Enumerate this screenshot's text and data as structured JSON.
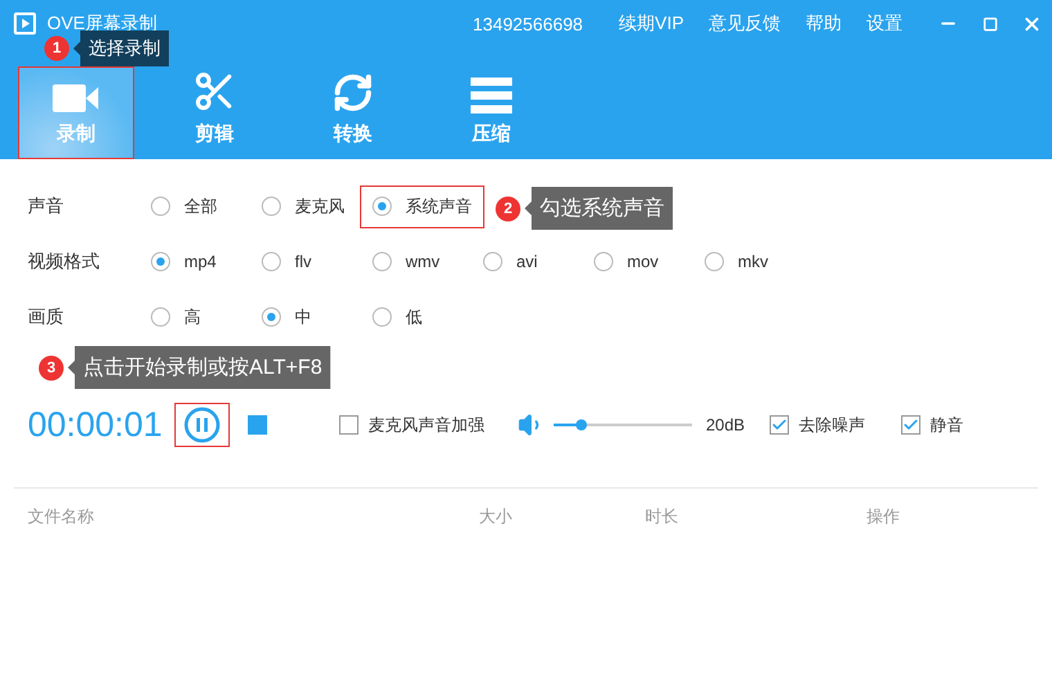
{
  "window": {
    "title": "OVE屏幕录制",
    "account": "13492566698",
    "links": [
      "续期VIP",
      "意见反馈",
      "帮助",
      "设置"
    ]
  },
  "tabs": [
    {
      "label": "录制",
      "selected": true,
      "highlighted": true
    },
    {
      "label": "剪辑",
      "selected": false,
      "highlighted": false
    },
    {
      "label": "转换",
      "selected": false,
      "highlighted": false
    },
    {
      "label": "压缩",
      "selected": false,
      "highlighted": false
    }
  ],
  "settings": [
    {
      "label": "声音",
      "options": [
        {
          "label": "全部",
          "selected": false,
          "highlighted": false
        },
        {
          "label": "麦克风",
          "selected": false,
          "highlighted": false
        },
        {
          "label": "系统声音",
          "selected": true,
          "highlighted": true
        }
      ]
    },
    {
      "label": "视频格式",
      "options": [
        {
          "label": "mp4",
          "selected": true,
          "highlighted": false
        },
        {
          "label": "flv",
          "selected": false,
          "highlighted": false
        },
        {
          "label": "wmv",
          "selected": false,
          "highlighted": false
        },
        {
          "label": "avi",
          "selected": false,
          "highlighted": false
        },
        {
          "label": "mov",
          "selected": false,
          "highlighted": false
        },
        {
          "label": "mkv",
          "selected": false,
          "highlighted": false
        }
      ]
    },
    {
      "label": "画质",
      "options": [
        {
          "label": "高",
          "selected": false,
          "highlighted": false
        },
        {
          "label": "中",
          "selected": true,
          "highlighted": false
        },
        {
          "label": "低",
          "selected": false,
          "highlighted": false
        }
      ]
    }
  ],
  "recorder": {
    "time": "00:00:01",
    "pause_highlighted": true,
    "mic_boost": {
      "label": "麦克风声音加强",
      "checked": false
    },
    "volume": {
      "level": 0.2,
      "reading": "20dB"
    },
    "toggles": [
      {
        "label": "去除噪声",
        "checked": true
      },
      {
        "label": "静音",
        "checked": true
      }
    ]
  },
  "table": {
    "columns": [
      "文件名称",
      "大小",
      "时长",
      "操作"
    ]
  },
  "annotations": [
    {
      "number": "1",
      "text": "选择录制"
    },
    {
      "number": "2",
      "text": "勾选系统声音"
    },
    {
      "number": "3",
      "text": "点击开始录制或按ALT+F8"
    }
  ]
}
